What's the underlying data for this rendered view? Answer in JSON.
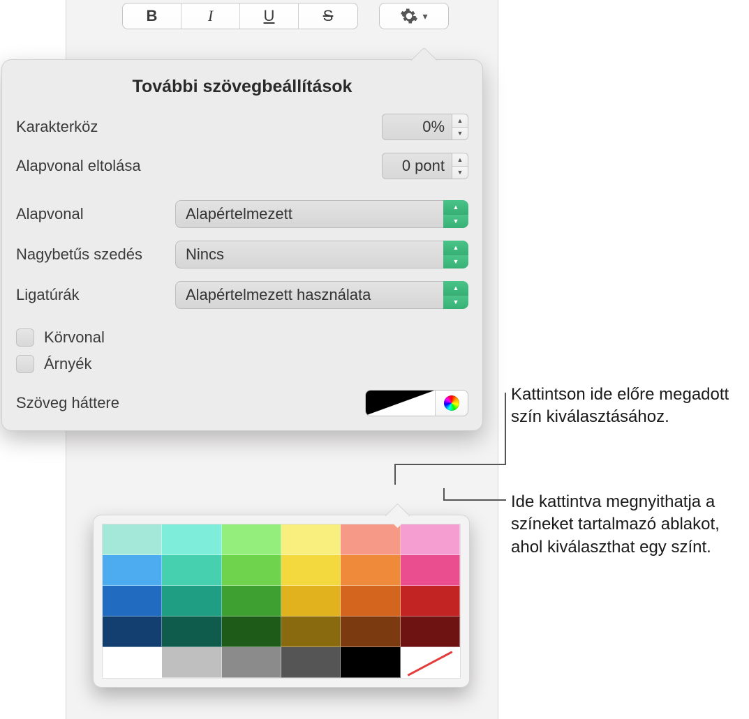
{
  "toolbar": {
    "bold": "B",
    "italic": "I",
    "underline": "U",
    "strike": "S"
  },
  "popover": {
    "title": "További szövegbeállítások",
    "char_spacing_label": "Karakterköz",
    "char_spacing_value": "0%",
    "baseline_shift_label": "Alapvonal eltolása",
    "baseline_shift_value": "0 pont",
    "baseline_label": "Alapvonal",
    "baseline_value": "Alapértelmezett",
    "caps_label": "Nagybetűs szedés",
    "caps_value": "Nincs",
    "ligatures_label": "Ligatúrák",
    "ligatures_value": "Alapértelmezett használata",
    "outline_label": "Körvonal",
    "shadow_label": "Árnyék",
    "text_bg_label": "Szöveg háttere"
  },
  "callouts": {
    "preset": "Kattintson ide előre megadott szín kiválasztásához.",
    "wheel": "Ide kattintva megnyithatja a színeket tartalmazó ablakot, ahol kiválaszthat egy színt."
  },
  "palette_colors": [
    [
      "#a3e8d8",
      "#7eeedb",
      "#94ee7c",
      "#f9ef7f",
      "#f69a87",
      "#f59ed2"
    ],
    [
      "#4dacf0",
      "#46d0b0",
      "#6fd34d",
      "#f3d93d",
      "#ef8a3a",
      "#ea4e8e"
    ],
    [
      "#216bc0",
      "#1f9e83",
      "#3ea031",
      "#e2b21e",
      "#d4651e",
      "#c22323"
    ],
    [
      "#123f70",
      "#0f5b4c",
      "#1e5a18",
      "#8a6a0f",
      "#7c3a10",
      "#6e1212"
    ],
    [
      "#ffffff",
      "#bfbfbf",
      "#8b8b8b",
      "#555555",
      "#000000",
      "none"
    ]
  ]
}
